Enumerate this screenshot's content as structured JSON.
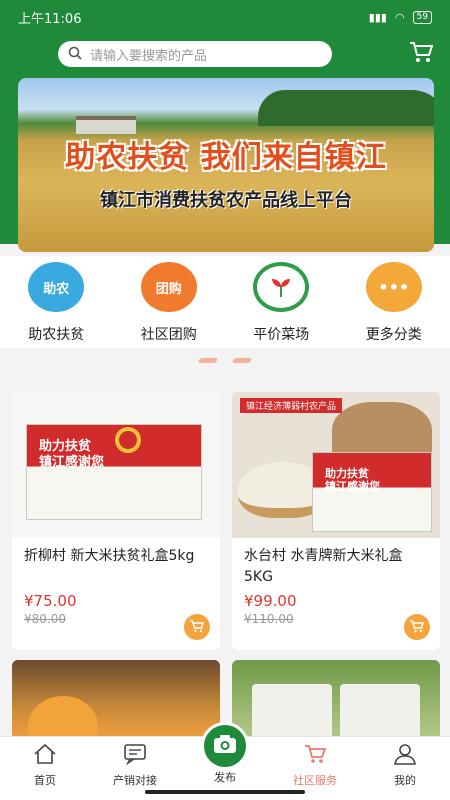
{
  "status": {
    "time": "上午11:06",
    "battery": "59"
  },
  "search": {
    "placeholder": "请输入要搜索的产品"
  },
  "banner": {
    "title": "助农扶贫 我们来自镇江",
    "subtitle": "镇江市消费扶贫农产品线上平台"
  },
  "categories": [
    {
      "label": "助农扶贫",
      "icon_text": "助农",
      "color": "#39a9e0"
    },
    {
      "label": "社区团购",
      "icon_text": "团购",
      "color": "#f07a2e"
    },
    {
      "label": "平价菜场",
      "icon_text": "",
      "color": "#2f9c48"
    },
    {
      "label": "更多分类",
      "icon_text": "•••",
      "color": "#f5a83a"
    }
  ],
  "products": [
    {
      "name": "折柳村 新大米扶贫礼盒5kg",
      "price": "¥75.00",
      "old_price": "¥80.00",
      "box_text_1": "助力扶贫",
      "box_text_2": "镇江感谢您"
    },
    {
      "name": "水台村 水青牌新大米礼盒 5KG",
      "price": "¥99.00",
      "old_price": "¥110.00",
      "tag": "镇江经济薄弱村农产品",
      "box_text_1": "助力扶贫",
      "box_text_2": "镇江感谢您"
    }
  ],
  "tabs": [
    {
      "label": "首页"
    },
    {
      "label": "产销对接"
    },
    {
      "label": "发布"
    },
    {
      "label": "社区服务"
    },
    {
      "label": "我的"
    }
  ],
  "colors": {
    "primary_green": "#1f8a3a",
    "price_red": "#e2332c",
    "accent_orange": "#f4a43a",
    "active_tab": "#e97b6b"
  }
}
